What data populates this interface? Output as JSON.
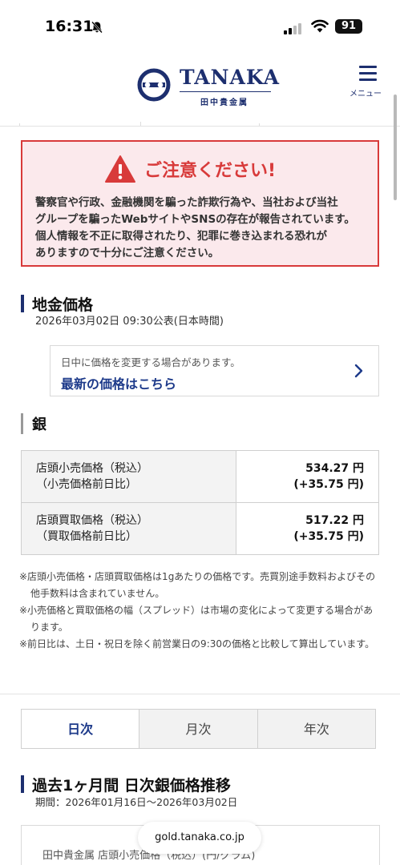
{
  "status_bar": {
    "time": "16:31",
    "battery": "91"
  },
  "header": {
    "logo_en": "TANAKA",
    "logo_jp": "田中貴金属",
    "menu_label": "メニュー"
  },
  "warning": {
    "title": "ご注意ください!",
    "lines": [
      "警察官や行政、金融機関を騙った詐欺行為や、当社および当社",
      "グループを騙ったWebサイトやSNSの存在が報告されています。",
      "個人情報を不正に取得されたり、犯罪に巻き込まれる恐れが",
      "ありますので十分にご注意ください。"
    ]
  },
  "price_section": {
    "title": "地金価格",
    "announced": "2026年03月02日 09:30公表(日本時間)",
    "notice_text": "日中に価格を変更する場合があります。",
    "notice_link": "最新の価格はこちら"
  },
  "silver": {
    "title": "銀",
    "rows": [
      {
        "label1": "店頭小売価格（税込）",
        "label2": "（小売価格前日比）",
        "value": "534.27 円",
        "change": "(+35.75 円)"
      },
      {
        "label1": "店頭買取価格（税込）",
        "label2": "（買取価格前日比）",
        "value": "517.22 円",
        "change": "(+35.75 円)"
      }
    ]
  },
  "notes": [
    "※店頭小売価格・店頭買取価格は1gあたりの価格です。売買別途手数料およびその他手数料は含まれていません。",
    "※小売価格と買取価格の幅（スプレッド）は市場の変化によって変更する場合があります。",
    "※前日比は、土日・祝日を除く前営業日の9:30の価格と比較して算出しています。"
  ],
  "period_tabs": [
    {
      "label": "日次",
      "active": true
    },
    {
      "label": "月次",
      "active": false
    },
    {
      "label": "年次",
      "active": false
    }
  ],
  "history": {
    "title": "過去1ヶ月間 日次銀価格推移",
    "period": "期間：2026年01月16日〜2026年03月02日",
    "chart_title": "田中貴金属 店頭小売価格（税込）(円/グラム)"
  },
  "browser": {
    "url": "gold.tanaka.co.jp"
  },
  "colors": {
    "navy": "#1d2f6f",
    "warning_red": "#d83a3a",
    "warning_bg": "#fbe9ec",
    "link_blue": "#1d3a8a"
  }
}
